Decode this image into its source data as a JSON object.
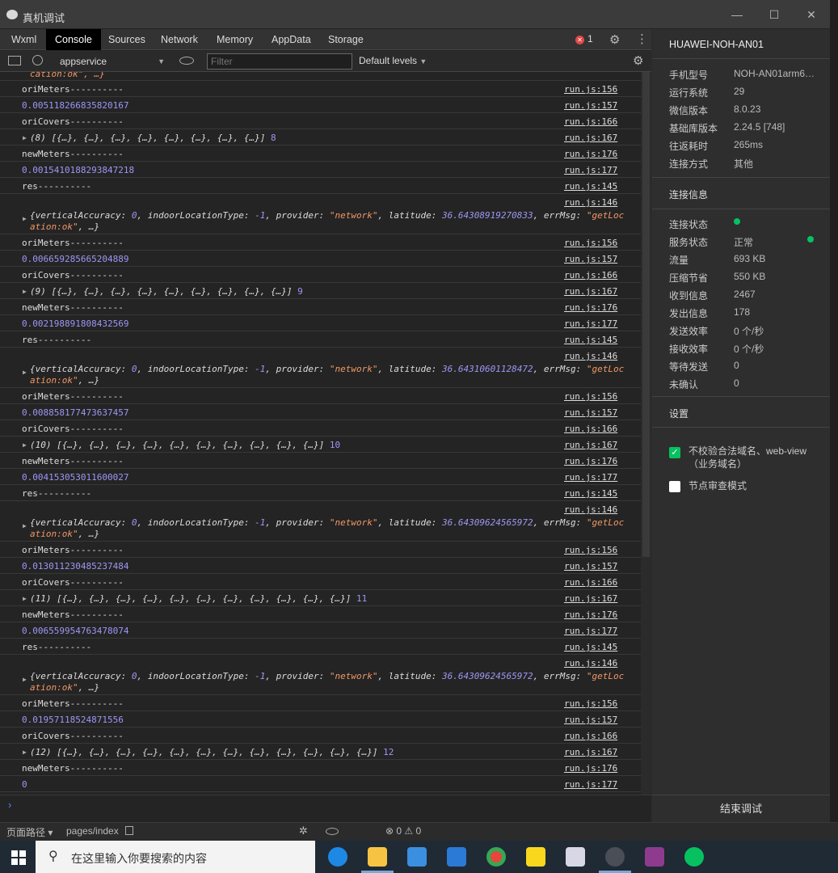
{
  "window": {
    "title": "真机调试"
  },
  "tabs": [
    "Wxml",
    "Console",
    "Sources",
    "Network",
    "Memory",
    "AppData",
    "Storage"
  ],
  "active_tab": "Console",
  "error_count": "1",
  "toolbar": {
    "context": "appservice",
    "filter_placeholder": "Filter",
    "levels": "Default levels"
  },
  "top_partial": "cation:ok\", …}",
  "rows": [
    {
      "type": "text",
      "msg": "oriMeters----------",
      "src": "run.js:156"
    },
    {
      "type": "num",
      "msg": "0.005118266835820167",
      "src": "run.js:157"
    },
    {
      "type": "text",
      "msg": "oriCovers----------",
      "src": "run.js:166"
    },
    {
      "type": "arr",
      "count": "8",
      "msg": "[{…}, {…}, {…}, {…}, {…}, {…}, {…}, {…}]",
      "tail": "8",
      "src": "run.js:167"
    },
    {
      "type": "text",
      "msg": "newMeters----------",
      "src": "run.js:176"
    },
    {
      "type": "num",
      "msg": "0.0015410188293847218",
      "src": "run.js:177"
    },
    {
      "type": "text",
      "msg": "res----------",
      "src": "run.js:145"
    },
    {
      "type": "obj",
      "lat": "36.64308919270833",
      "src": "run.js:146"
    },
    {
      "type": "text",
      "msg": "oriMeters----------",
      "src": "run.js:156"
    },
    {
      "type": "num",
      "msg": "0.006659285665204889",
      "src": "run.js:157"
    },
    {
      "type": "text",
      "msg": "oriCovers----------",
      "src": "run.js:166"
    },
    {
      "type": "arr",
      "count": "9",
      "msg": "[{…}, {…}, {…}, {…}, {…}, {…}, {…}, {…}, {…}]",
      "tail": "9",
      "src": "run.js:167"
    },
    {
      "type": "text",
      "msg": "newMeters----------",
      "src": "run.js:176"
    },
    {
      "type": "num",
      "msg": "0.002198891808432569",
      "src": "run.js:177"
    },
    {
      "type": "text",
      "msg": "res----------",
      "src": "run.js:145"
    },
    {
      "type": "obj",
      "lat": "36.64310601128472",
      "src": "run.js:146"
    },
    {
      "type": "text",
      "msg": "oriMeters----------",
      "src": "run.js:156"
    },
    {
      "type": "num",
      "msg": "0.008858177473637457",
      "src": "run.js:157"
    },
    {
      "type": "text",
      "msg": "oriCovers----------",
      "src": "run.js:166"
    },
    {
      "type": "arr",
      "count": "10",
      "msg": "[{…}, {…}, {…}, {…}, {…}, {…}, {…}, {…}, {…}, {…}]",
      "tail": "10",
      "src": "run.js:167"
    },
    {
      "type": "text",
      "msg": "newMeters----------",
      "src": "run.js:176"
    },
    {
      "type": "num",
      "msg": "0.004153053011600027",
      "src": "run.js:177"
    },
    {
      "type": "text",
      "msg": "res----------",
      "src": "run.js:145"
    },
    {
      "type": "obj",
      "lat": "36.64309624565972",
      "src": "run.js:146"
    },
    {
      "type": "text",
      "msg": "oriMeters----------",
      "src": "run.js:156"
    },
    {
      "type": "num",
      "msg": "0.013011230485237484",
      "src": "run.js:157"
    },
    {
      "type": "text",
      "msg": "oriCovers----------",
      "src": "run.js:166"
    },
    {
      "type": "arr",
      "count": "11",
      "msg": "[{…}, {…}, {…}, {…}, {…}, {…}, {…}, {…}, {…}, {…}, {…}]",
      "tail": "11",
      "src": "run.js:167"
    },
    {
      "type": "text",
      "msg": "newMeters----------",
      "src": "run.js:176"
    },
    {
      "type": "num",
      "msg": "0.006559954763478074",
      "src": "run.js:177"
    },
    {
      "type": "text",
      "msg": "res----------",
      "src": "run.js:145"
    },
    {
      "type": "obj",
      "lat": "36.64309624565972",
      "src": "run.js:146"
    },
    {
      "type": "text",
      "msg": "oriMeters----------",
      "src": "run.js:156"
    },
    {
      "type": "num",
      "msg": "0.01957118524871556",
      "src": "run.js:157"
    },
    {
      "type": "text",
      "msg": "oriCovers----------",
      "src": "run.js:166"
    },
    {
      "type": "arr",
      "count": "12",
      "msg": "[{…}, {…}, {…}, {…}, {…}, {…}, {…}, {…}, {…}, {…}, {…}, {…}]",
      "tail": "12",
      "src": "run.js:167"
    },
    {
      "type": "text",
      "msg": "newMeters----------",
      "src": "run.js:176"
    },
    {
      "type": "num",
      "msg": "0",
      "src": "run.js:177"
    }
  ],
  "obj_parts": {
    "k1": "verticalAccuracy: ",
    "v1": "0",
    "k2": ", indoorLocationType: ",
    "v2": "-1",
    "k3": ", provider: ",
    "v3": "\"network\"",
    "k4": ", latitude: ",
    "k5": ", errMsg: ",
    "v5a": "\"getLoc",
    "line2a": "ation:ok\"",
    "line2b": ", …}"
  },
  "panel": {
    "device": "HUAWEI-NOH-AN01",
    "info": [
      {
        "label": "手机型号",
        "value": "NOH-AN01arm6…"
      },
      {
        "label": "运行系统",
        "value": "29"
      },
      {
        "label": "微信版本",
        "value": "8.0.23"
      },
      {
        "label": "基础库版本",
        "value": "2.24.5 [748]"
      },
      {
        "label": "往返耗时",
        "value": "265ms"
      },
      {
        "label": "连接方式",
        "value": "其他"
      }
    ],
    "conn_title": "连接信息",
    "conn": [
      {
        "label": "连接状态",
        "value": ""
      },
      {
        "label": "服务状态",
        "value": "正常"
      },
      {
        "label": "流量",
        "value": "693 KB"
      },
      {
        "label": "压缩节省",
        "value": "550 KB"
      },
      {
        "label": "收到信息",
        "value": "2467"
      },
      {
        "label": "发出信息",
        "value": "178"
      },
      {
        "label": "发送效率",
        "value": "0 个/秒"
      },
      {
        "label": "接收效率",
        "value": "0 个/秒"
      },
      {
        "label": "等待发送",
        "value": "0"
      },
      {
        "label": "未确认",
        "value": "0"
      }
    ],
    "settings_title": "设置",
    "opt1": "不校验合法域名、web-view（业务域名）",
    "opt2": "节点审查模式",
    "end_button": "结束调试"
  },
  "statusbar": {
    "path_label": "页面路径",
    "path": "pages/index",
    "counts": "⊗ 0 ⚠ 0"
  },
  "taskbar": {
    "search_placeholder": "在这里输入你要搜索的内容"
  },
  "colors": {
    "accent": "#07c160",
    "number": "#9d97f5",
    "string": "#f29766"
  }
}
